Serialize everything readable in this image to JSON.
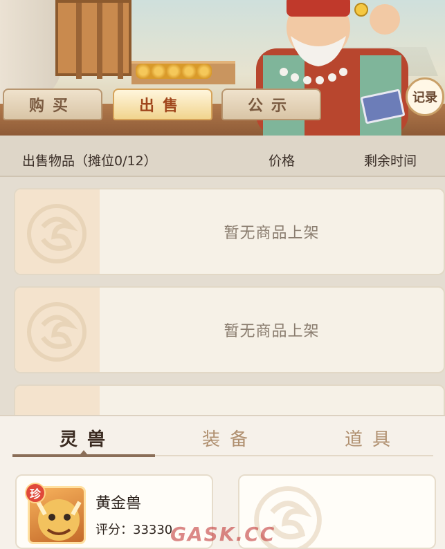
{
  "tabs": [
    {
      "label": "购买",
      "active": false
    },
    {
      "label": "出售",
      "active": true
    },
    {
      "label": "公示",
      "active": false
    }
  ],
  "record_button": {
    "label": "记录"
  },
  "list_header": {
    "item_label": "出售物品（摊位0/12）",
    "price_label": "价格",
    "time_label": "剩余时间"
  },
  "slots": [
    {
      "empty_text": "暂无商品上架"
    },
    {
      "empty_text": "暂无商品上架"
    }
  ],
  "inventory": {
    "tabs": [
      {
        "label": "灵兽",
        "active": true
      },
      {
        "label": "装备",
        "active": false
      },
      {
        "label": "道具",
        "active": false
      }
    ],
    "items": [
      {
        "badge": "珍",
        "name": "黄金兽",
        "score_label": "评分：",
        "score": "33330"
      }
    ]
  },
  "watermark": "GASK.CC",
  "icons": [
    "merchant-illustration",
    "book-icon",
    "emblem-placeholder-icon",
    "golden-beast-portrait"
  ],
  "colors": {
    "accent": "#a0461c",
    "tab_active_bg": "#f1d48e",
    "rare_badge": "#e0483a"
  }
}
